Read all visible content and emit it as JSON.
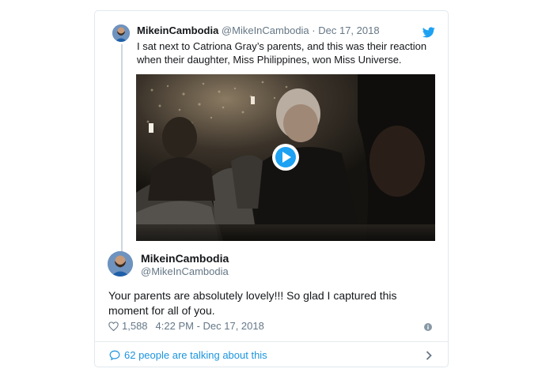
{
  "quoted_tweet": {
    "author_name": "MikeinCambodia",
    "author_handle": "@MikeInCambodia",
    "separator": " · ",
    "date": "Dec 17, 2018",
    "text": "I sat next to Catriona Gray’s parents, and this was their reaction when their daughter, Miss Philippines, won Miss Universe.",
    "media": "video",
    "icon": "twitter-bird-icon"
  },
  "tweet": {
    "author_name": "MikeinCambodia",
    "author_handle": "@MikeInCambodia",
    "text": "Your parents are absolutely lovely!!!  So glad I captured this moment for all of you.",
    "likes": "1,588",
    "timestamp": "4:22 PM - Dec 17, 2018"
  },
  "footer": {
    "talking_text": "62 people are talking about this"
  },
  "colors": {
    "accent": "#1b95e0",
    "muted": "#657786",
    "border": "#e1e8ed",
    "twitter_blue": "#1da1f2"
  }
}
